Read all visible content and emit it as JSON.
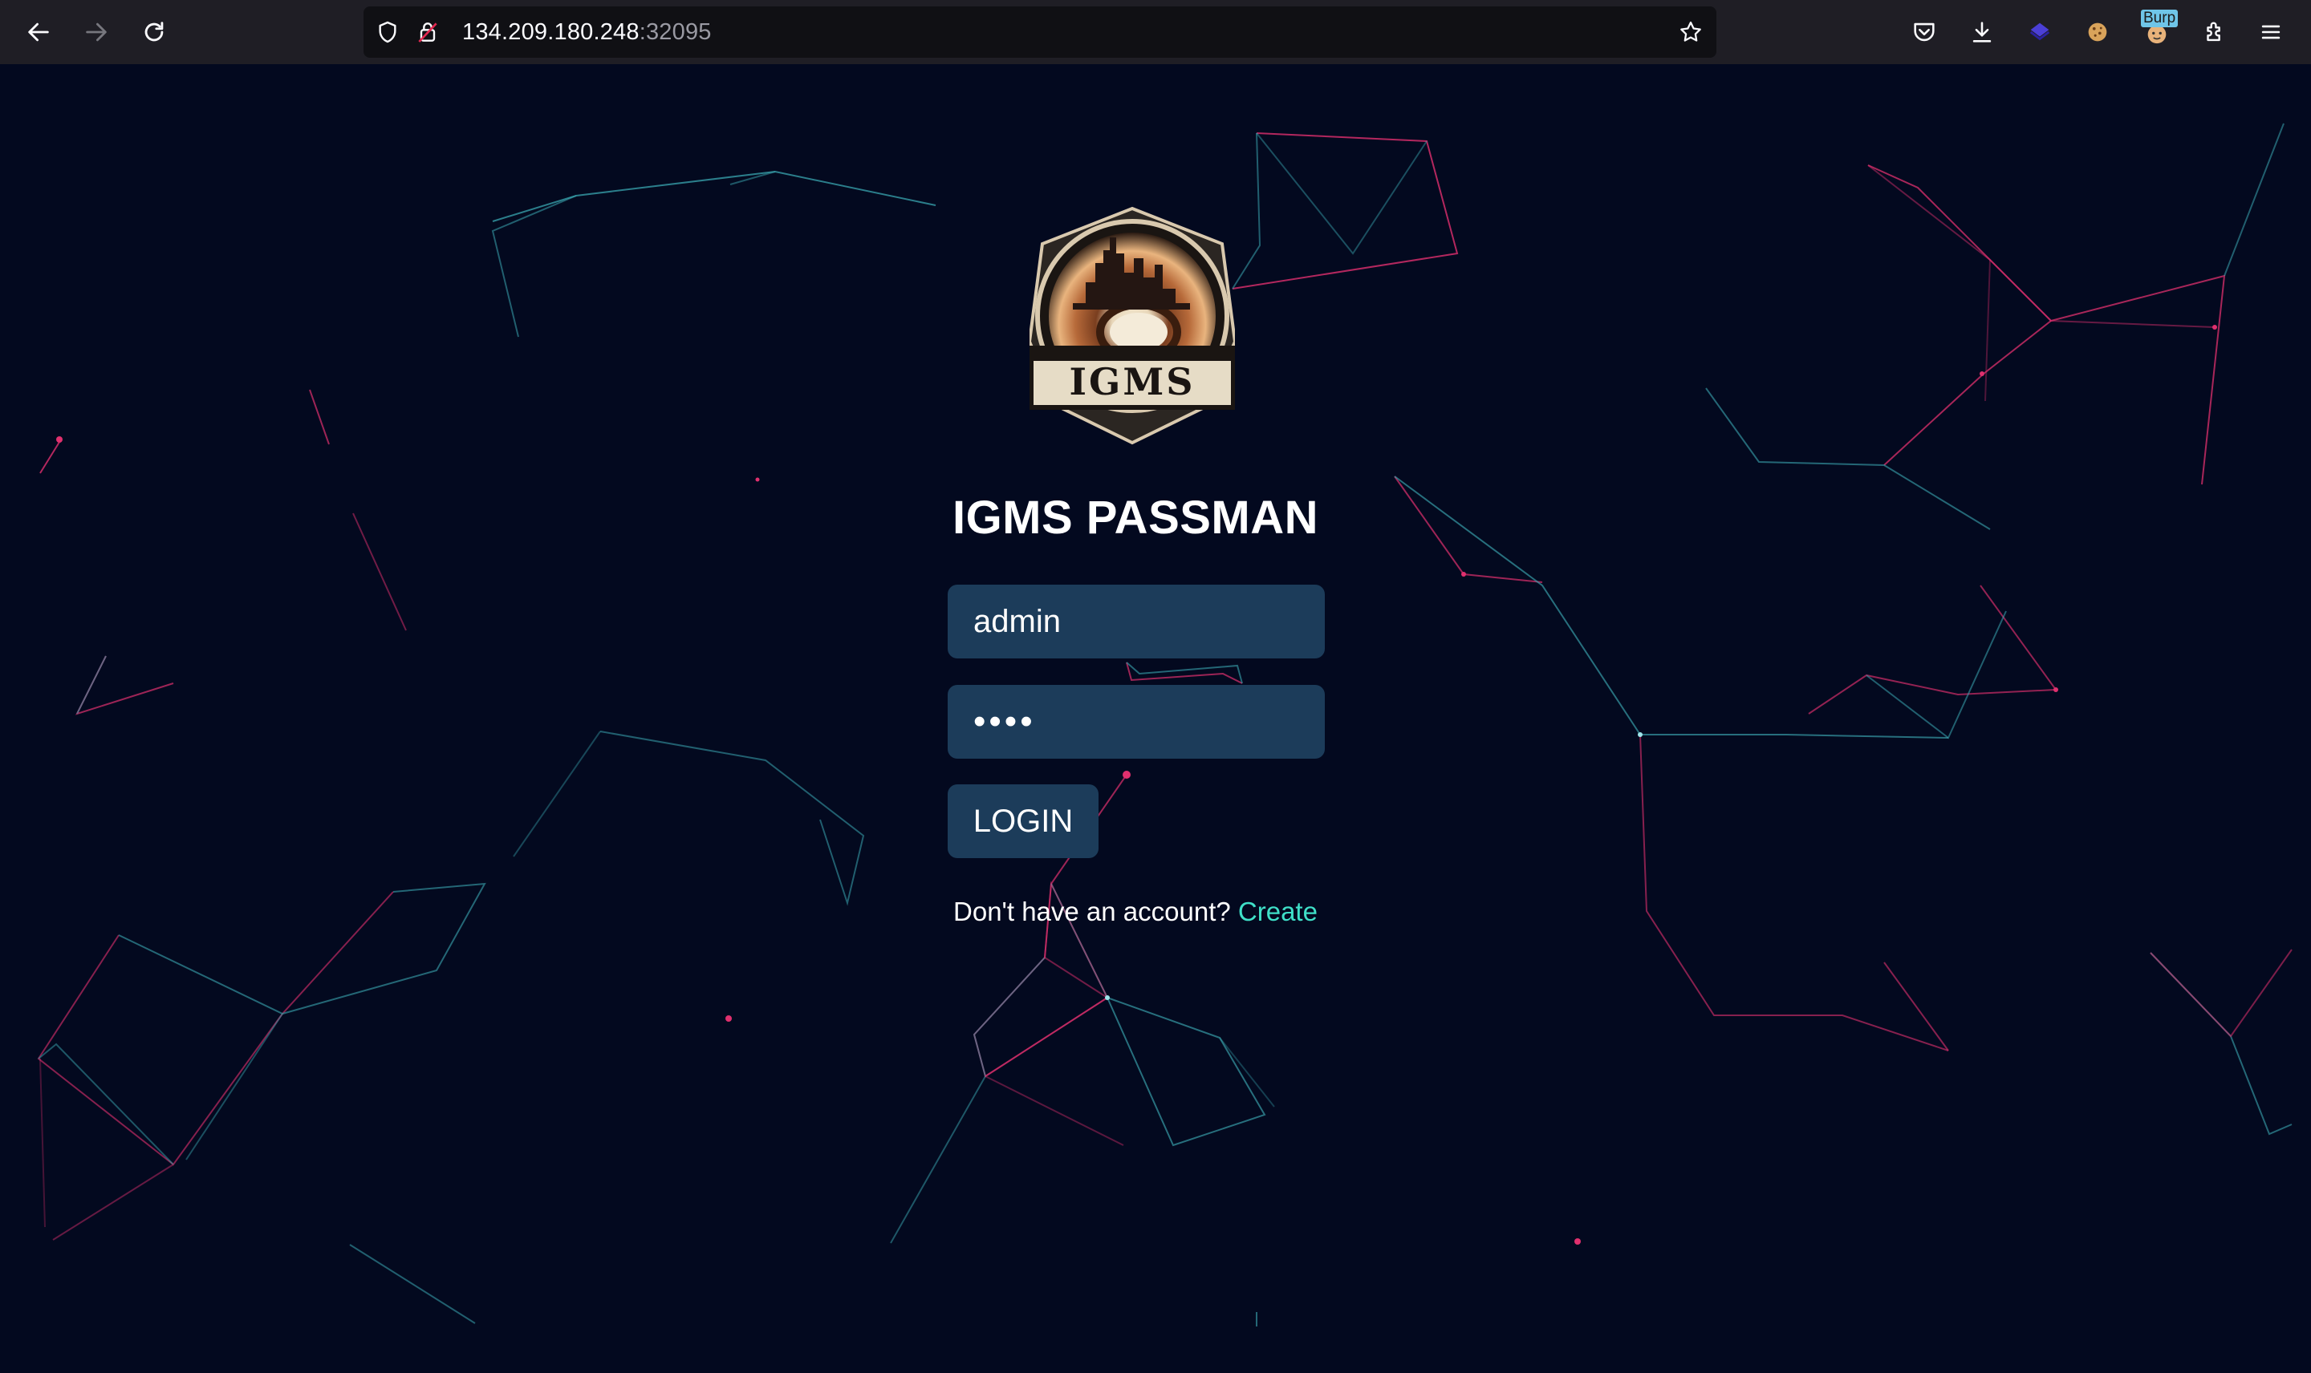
{
  "browser": {
    "url_host": "134.209.180.248",
    "url_port": ":32095",
    "extension_badge": "Burp"
  },
  "app": {
    "logo_text": "IGMS",
    "title": "IGMS PASSMAN",
    "username_value": "admin",
    "password_value": "••••",
    "login_label": "LOGIN",
    "signup_prompt": "Don't have an account?",
    "signup_link": "Create"
  },
  "colors": {
    "background": "#03091f",
    "field": "#1c3c5a",
    "link": "#3fe0c8",
    "network_teal": "#3aa6b0",
    "network_pink": "#e0306e"
  },
  "icons": [
    "back-icon",
    "forward-icon",
    "reload-icon",
    "shield-icon",
    "lock-icon",
    "bookmark-star-icon",
    "pocket-icon",
    "download-icon",
    "extension-cube-icon",
    "cookie-icon",
    "burp-icon",
    "extensions-icon",
    "menu-icon"
  ]
}
